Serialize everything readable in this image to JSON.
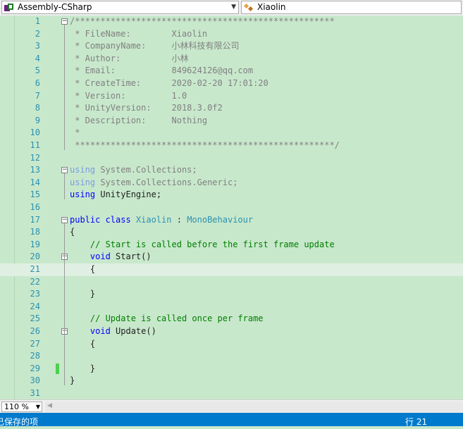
{
  "toolbar": {
    "project_dropdown": "Assembly-CSharp",
    "class_dropdown": "Xiaolin",
    "project_icon": "csharp-project-icon",
    "class_icon": "class-icon"
  },
  "editor": {
    "lines": [
      {
        "n": "1",
        "parts": [
          [
            "gr",
            "/***************************************************"
          ]
        ]
      },
      {
        "n": "2",
        "parts": [
          [
            "gr",
            " * FileName:        Xiaolin"
          ]
        ]
      },
      {
        "n": "3",
        "parts": [
          [
            "gr",
            " * CompanyName:     小林科技有限公司"
          ]
        ]
      },
      {
        "n": "4",
        "parts": [
          [
            "gr",
            " * Author:          小林"
          ]
        ]
      },
      {
        "n": "5",
        "parts": [
          [
            "gr",
            " * Email:           849624126@qq.com"
          ]
        ]
      },
      {
        "n": "6",
        "parts": [
          [
            "gr",
            " * CreateTime:      2020-02-20 17:01:20"
          ]
        ]
      },
      {
        "n": "7",
        "parts": [
          [
            "gr",
            " * Version:         1.0"
          ]
        ]
      },
      {
        "n": "8",
        "parts": [
          [
            "gr",
            " * UnityVersion:    2018.3.0f2"
          ]
        ]
      },
      {
        "n": "9",
        "parts": [
          [
            "gr",
            " * Description:     Nothing"
          ]
        ]
      },
      {
        "n": "10",
        "parts": [
          [
            "gr",
            " *"
          ]
        ]
      },
      {
        "n": "11",
        "parts": [
          [
            "gr",
            " ***************************************************/"
          ]
        ]
      },
      {
        "n": "12",
        "parts": []
      },
      {
        "n": "13",
        "parts": [
          [
            "kwg",
            "using"
          ],
          [
            "gr",
            " System.Collections;"
          ]
        ]
      },
      {
        "n": "14",
        "parts": [
          [
            "kwg",
            "using"
          ],
          [
            "gr",
            " System.Collections.Generic;"
          ]
        ]
      },
      {
        "n": "15",
        "parts": [
          [
            "kw",
            "using"
          ],
          [
            "tx",
            " UnityEngine;"
          ]
        ]
      },
      {
        "n": "16",
        "parts": []
      },
      {
        "n": "17",
        "parts": [
          [
            "kw",
            "public class "
          ],
          [
            "ty",
            "Xiaolin"
          ],
          [
            "tx",
            " : "
          ],
          [
            "ty",
            "MonoBehaviour"
          ]
        ]
      },
      {
        "n": "18",
        "parts": [
          [
            "tx",
            "{"
          ]
        ]
      },
      {
        "n": "19",
        "parts": [
          [
            "cm",
            "    // Start is called before the first frame update"
          ]
        ]
      },
      {
        "n": "20",
        "parts": [
          [
            "kw",
            "    void "
          ],
          [
            "tx",
            "Start()"
          ]
        ]
      },
      {
        "n": "21",
        "parts": [
          [
            "tx",
            "    {"
          ]
        ]
      },
      {
        "n": "22",
        "parts": []
      },
      {
        "n": "23",
        "parts": [
          [
            "tx",
            "    }"
          ]
        ]
      },
      {
        "n": "24",
        "parts": []
      },
      {
        "n": "25",
        "parts": [
          [
            "cm",
            "    // Update is called once per frame"
          ]
        ]
      },
      {
        "n": "26",
        "parts": [
          [
            "kw",
            "    void "
          ],
          [
            "tx",
            "Update()"
          ]
        ]
      },
      {
        "n": "27",
        "parts": [
          [
            "tx",
            "    {"
          ]
        ]
      },
      {
        "n": "28",
        "parts": []
      },
      {
        "n": "29",
        "parts": [
          [
            "tx",
            "    }"
          ]
        ]
      },
      {
        "n": "30",
        "parts": [
          [
            "tx",
            "}"
          ]
        ]
      },
      {
        "n": "31",
        "parts": []
      }
    ]
  },
  "zoom": {
    "value": "110 %"
  },
  "status": {
    "left": "已保存的项",
    "right": "行 21"
  },
  "colors": {
    "editor_bg": "#c8e8cc",
    "status_bg": "#007acc",
    "line_number": "#2b91af",
    "keyword": "#0000ff",
    "comment": "#008000"
  }
}
